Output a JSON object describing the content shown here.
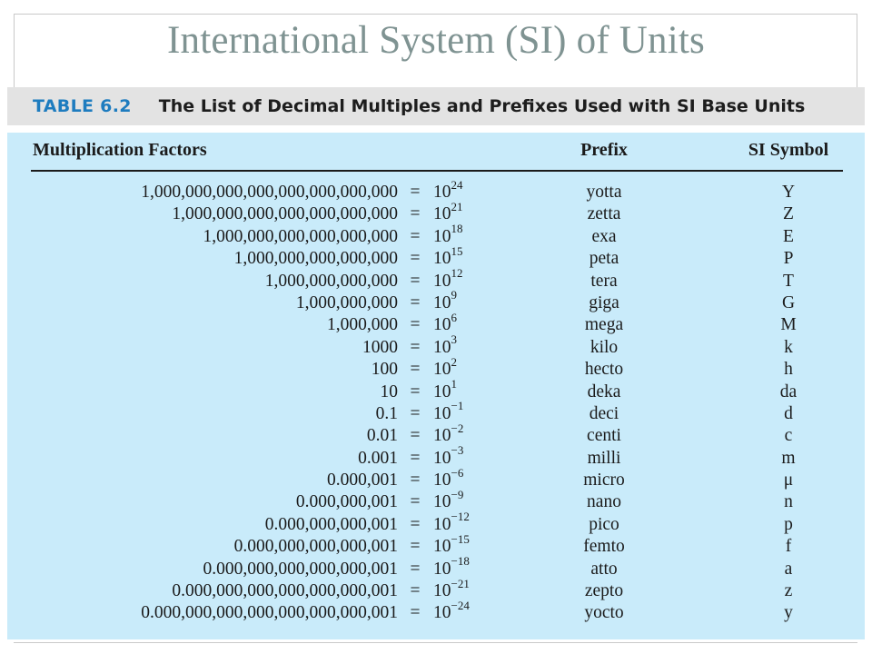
{
  "slide": {
    "title": "International System (SI) of Units"
  },
  "table": {
    "number": "TABLE 6.2",
    "caption": "The List of Decimal Multiples and Prefixes Used with SI Base Units",
    "headers": {
      "factor": "Multiplication Factors",
      "prefix": "Prefix",
      "symbol": "SI Symbol"
    },
    "rows": [
      {
        "value": "1,000,000,000,000,000,000,000,000",
        "eq": "=",
        "base": "10",
        "exp": "24",
        "prefix": "yotta",
        "symbol": "Y"
      },
      {
        "value": "1,000,000,000,000,000,000,000",
        "eq": "=",
        "base": "10",
        "exp": "21",
        "prefix": "zetta",
        "symbol": "Z"
      },
      {
        "value": "1,000,000,000,000,000,000",
        "eq": "=",
        "base": "10",
        "exp": "18",
        "prefix": "exa",
        "symbol": "E"
      },
      {
        "value": "1,000,000,000,000,000",
        "eq": "=",
        "base": "10",
        "exp": "15",
        "prefix": "peta",
        "symbol": "P"
      },
      {
        "value": "1,000,000,000,000",
        "eq": "=",
        "base": "10",
        "exp": "12",
        "prefix": "tera",
        "symbol": "T"
      },
      {
        "value": "1,000,000,000",
        "eq": "=",
        "base": "10",
        "exp": "9",
        "prefix": "giga",
        "symbol": "G"
      },
      {
        "value": "1,000,000",
        "eq": "=",
        "base": "10",
        "exp": "6",
        "prefix": "mega",
        "symbol": "M"
      },
      {
        "value": "1000",
        "eq": "=",
        "base": "10",
        "exp": "3",
        "prefix": "kilo",
        "symbol": "k"
      },
      {
        "value": "100",
        "eq": "=",
        "base": "10",
        "exp": "2",
        "prefix": "hecto",
        "symbol": "h"
      },
      {
        "value": "10",
        "eq": "=",
        "base": "10",
        "exp": "1",
        "prefix": "deka",
        "symbol": "da"
      },
      {
        "value": "0.1",
        "eq": "=",
        "base": "10",
        "exp": "−1",
        "prefix": "deci",
        "symbol": "d"
      },
      {
        "value": "0.01",
        "eq": "=",
        "base": "10",
        "exp": "−2",
        "prefix": "centi",
        "symbol": "c"
      },
      {
        "value": "0.001",
        "eq": "=",
        "base": "10",
        "exp": "−3",
        "prefix": "milli",
        "symbol": "m"
      },
      {
        "value": "0.000,001",
        "eq": "=",
        "base": "10",
        "exp": "−6",
        "prefix": "micro",
        "symbol": "μ"
      },
      {
        "value": "0.000,000,001",
        "eq": "=",
        "base": "10",
        "exp": "−9",
        "prefix": "nano",
        "symbol": "n"
      },
      {
        "value": "0.000,000,000,001",
        "eq": "=",
        "base": "10",
        "exp": "−12",
        "prefix": "pico",
        "symbol": "p"
      },
      {
        "value": "0.000,000,000,000,001",
        "eq": "=",
        "base": "10",
        "exp": "−15",
        "prefix": "femto",
        "symbol": "f"
      },
      {
        "value": "0.000,000,000,000,000,001",
        "eq": "=",
        "base": "10",
        "exp": "−18",
        "prefix": "atto",
        "symbol": "a"
      },
      {
        "value": "0.000,000,000,000,000,000,001",
        "eq": "=",
        "base": "10",
        "exp": "−21",
        "prefix": "zepto",
        "symbol": "z"
      },
      {
        "value": "0.000,000,000,000,000,000,000,001",
        "eq": "=",
        "base": "10",
        "exp": "−24",
        "prefix": "yocto",
        "symbol": "y"
      }
    ]
  },
  "colors": {
    "title": "#7f9392",
    "table_number": "#1e7cbf",
    "caption_band": "#e3e3e3",
    "table_panel": "#c9ebfa"
  }
}
